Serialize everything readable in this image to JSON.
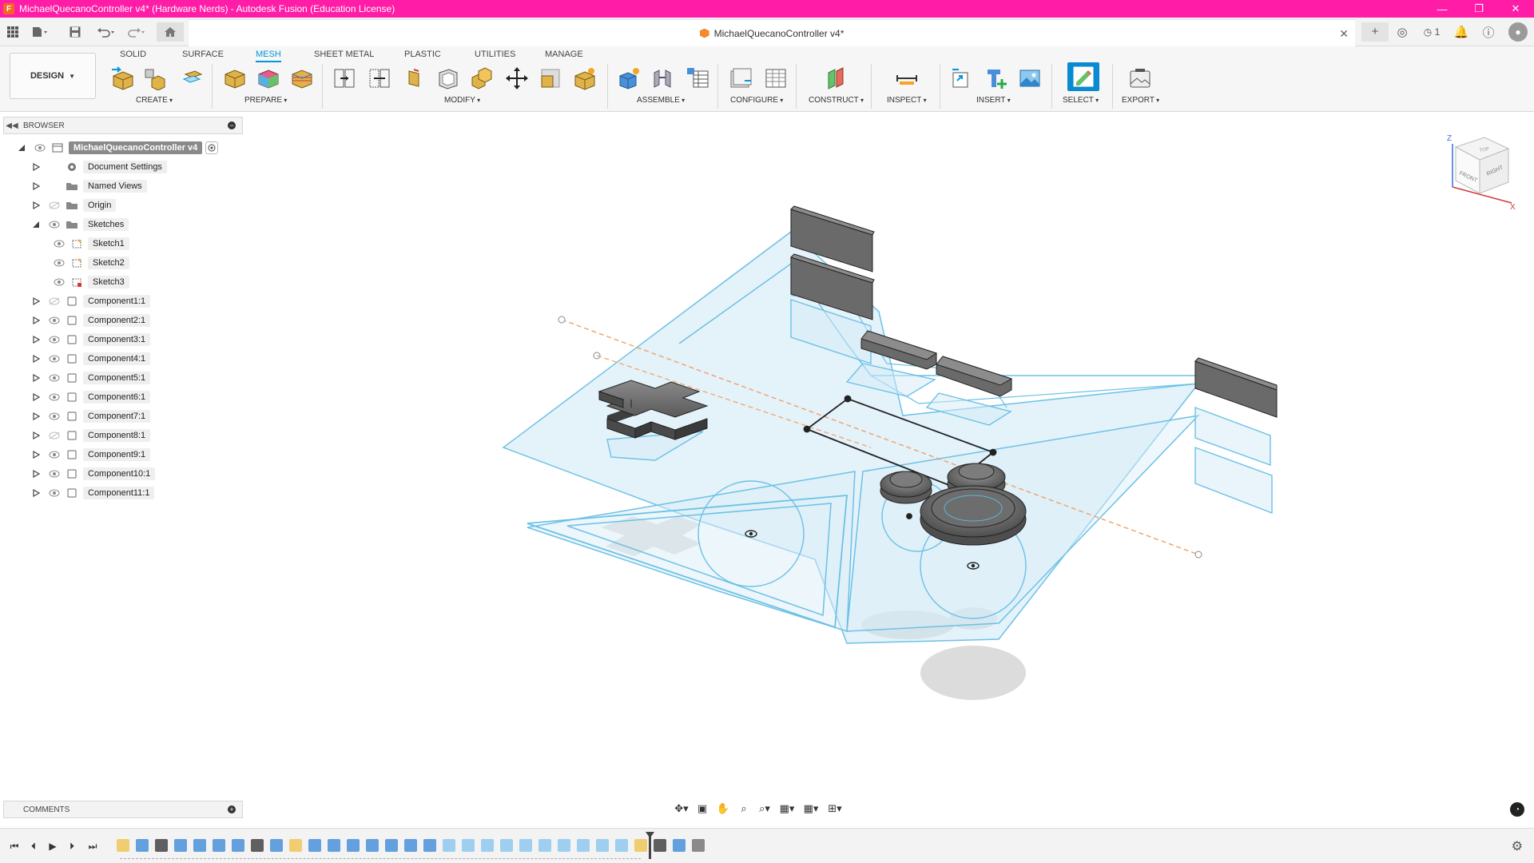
{
  "titlebar": {
    "title": "MichaelQuecanoController v4* (Hardware Nerds) - Autodesk Fusion (Education License)",
    "minimize": "—",
    "restore": "❐",
    "close": "✕",
    "accent_color": "#ff1ca6"
  },
  "doc_tab": {
    "title": "MichaelQuecanoController v4*",
    "close": "✕"
  },
  "qa_right": {
    "job_count": "1"
  },
  "workspace": {
    "label": "DESIGN"
  },
  "ribbon_tabs": [
    {
      "label": "SOLID"
    },
    {
      "label": "SURFACE"
    },
    {
      "label": "MESH",
      "active": true
    },
    {
      "label": "SHEET METAL"
    },
    {
      "label": "PLASTIC"
    },
    {
      "label": "UTILITIES"
    },
    {
      "label": "MANAGE"
    }
  ],
  "ribbon_groups": [
    {
      "label": "CREATE"
    },
    {
      "label": "PREPARE"
    },
    {
      "label": "MODIFY"
    },
    {
      "label": "ASSEMBLE"
    },
    {
      "label": "CONFIGURE"
    },
    {
      "label": "CONSTRUCT"
    },
    {
      "label": "INSPECT"
    },
    {
      "label": "INSERT"
    },
    {
      "label": "SELECT"
    },
    {
      "label": "EXPORT"
    }
  ],
  "browser": {
    "title": "BROWSER",
    "root": "MichaelQuecanoController v4",
    "nodes": [
      {
        "label": "Document Settings",
        "icon": "gear-icon"
      },
      {
        "label": "Named Views",
        "icon": "folder-icon"
      },
      {
        "label": "Origin",
        "icon": "folder-icon",
        "hidden": true
      },
      {
        "label": "Sketches",
        "icon": "folder-icon",
        "expanded": true
      },
      {
        "label": "Sketch1",
        "icon": "sketch-icon"
      },
      {
        "label": "Sketch2",
        "icon": "sketch-icon"
      },
      {
        "label": "Sketch3",
        "icon": "sketch-error-icon"
      },
      {
        "label": "Component1:1",
        "icon": "component-icon",
        "hidden": true
      },
      {
        "label": "Component2:1",
        "icon": "component-icon"
      },
      {
        "label": "Component3:1",
        "icon": "component-icon"
      },
      {
        "label": "Component4:1",
        "icon": "component-icon"
      },
      {
        "label": "Component5:1",
        "icon": "component-icon"
      },
      {
        "label": "Component6:1",
        "icon": "component-icon"
      },
      {
        "label": "Component7:1",
        "icon": "component-icon"
      },
      {
        "label": "Component8:1",
        "icon": "component-icon",
        "hidden": true
      },
      {
        "label": "Component9:1",
        "icon": "component-icon"
      },
      {
        "label": "Component10:1",
        "icon": "component-icon"
      },
      {
        "label": "Component11:1",
        "icon": "component-icon"
      }
    ]
  },
  "viewcube": {
    "top": "TOP",
    "front": "FRONT",
    "right": "RIGHT",
    "axis_z": "Z",
    "axis_x": "X"
  },
  "comments": {
    "title": "COMMENTS"
  },
  "colors": {
    "accent": "#0696d7",
    "sketch_line": "#5bb8dd",
    "body_dark": "#5f5f5f",
    "title_bar": "#ff1ca6"
  }
}
